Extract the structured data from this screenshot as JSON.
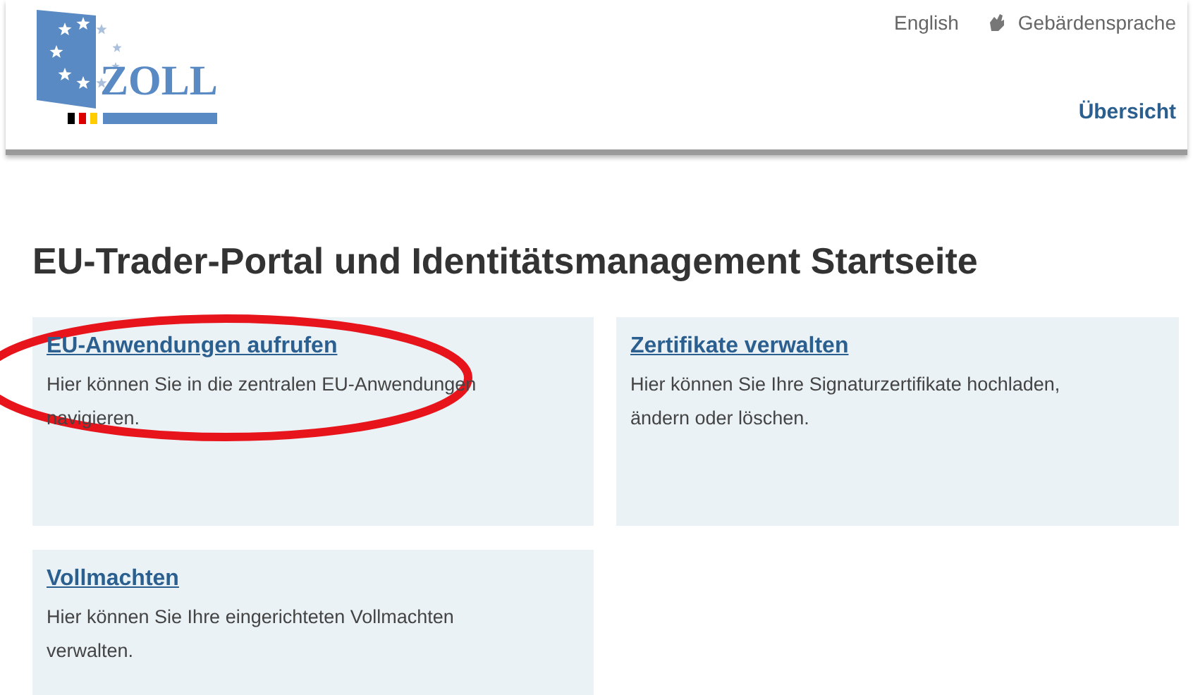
{
  "header": {
    "logo_text": "ZOLL",
    "links": [
      {
        "label": "English",
        "kind": "text"
      },
      {
        "label": "Gebärdensprache",
        "kind": "sign"
      }
    ],
    "nav": [
      {
        "label": "Übersicht"
      }
    ]
  },
  "title": "EU-Trader-Portal und Identitätsmanagement Startseite",
  "cards": [
    {
      "title": "EU-Anwendungen aufrufen",
      "text": "Hier können Sie in die zentralen EU-Anwendungen navigieren."
    },
    {
      "title": "Zertifikate verwalten",
      "text": "Hier können Sie Ihre Signaturzertifikate hochladen, ändern oder löschen."
    },
    {
      "title": "Vollmachten",
      "text": "Hier können Sie Ihre eingerichteten Vollmachten verwalten."
    }
  ],
  "annotation": {
    "kind": "ellipse"
  }
}
